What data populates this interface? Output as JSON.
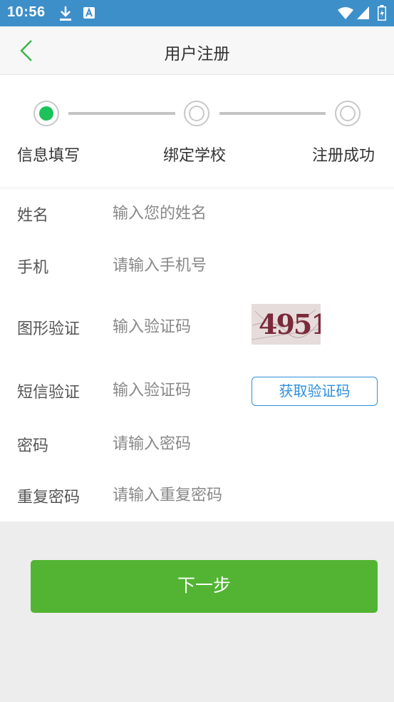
{
  "status_bar": {
    "time": "10:56",
    "icons": [
      "download-icon",
      "a-icon",
      "wifi-icon",
      "signal-icon",
      "battery-icon"
    ]
  },
  "header": {
    "title": "用户注册",
    "back_icon": "chevron-left-icon"
  },
  "steps": [
    {
      "label": "信息填写",
      "state": "active"
    },
    {
      "label": "绑定学校",
      "state": "idle"
    },
    {
      "label": "注册成功",
      "state": "idle"
    }
  ],
  "form": {
    "name": {
      "label": "姓名",
      "placeholder": "输入您的姓名"
    },
    "phone": {
      "label": "手机",
      "placeholder": "请输入手机号"
    },
    "captcha": {
      "label": "图形验证",
      "placeholder": "输入验证码",
      "image_text": "4951"
    },
    "sms": {
      "label": "短信验证",
      "placeholder": "输入验证码",
      "button": "获取验证码"
    },
    "password": {
      "label": "密码",
      "placeholder": "请输入密码"
    },
    "confirm_password": {
      "label": "重复密码",
      "placeholder": "请输入重复密码"
    }
  },
  "next_button": "下一步",
  "colors": {
    "status_bar": "#3d8fc9",
    "accent_green": "#53b433",
    "step_active": "#1dc25a",
    "sms_button_blue": "#2f8fdc",
    "back_icon": "#39b54a"
  }
}
